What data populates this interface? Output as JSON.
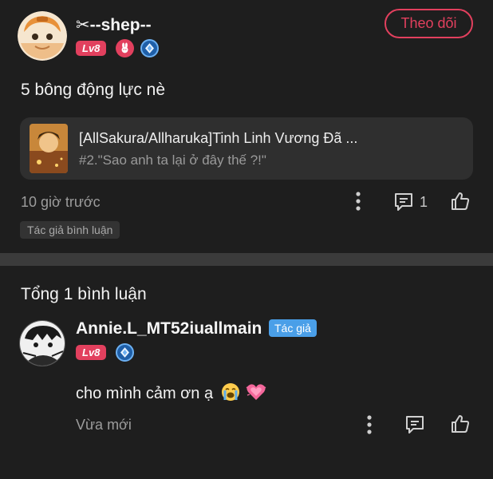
{
  "post": {
    "author": {
      "name": "✂--shep--",
      "level": "Lv8"
    },
    "follow_label": "Theo dõi",
    "title": "5 bông động lực nè",
    "story": {
      "title": "[AllSakura/Allharuka]Tinh Linh Vương Đã ...",
      "chapter": "#2.\"Sao anh ta lại ở đây thế ?!\""
    },
    "time": "10 giờ trước",
    "comment_count": "1",
    "tag": "Tác giả bình luận"
  },
  "comments_section": {
    "heading": "Tổng 1 bình luận",
    "comments": [
      {
        "author": "Annie.L_MT52iuallmain",
        "author_tag": "Tác giả",
        "level": "Lv8",
        "text": "cho mình cảm ơn ạ",
        "emojis": [
          "loudly-crying-face",
          "growing-heart"
        ],
        "time": "Vừa mới"
      }
    ]
  },
  "colors": {
    "background": "#1e1e1e",
    "accent": "#e2405e",
    "card": "#2f2f2f",
    "author_tag": "#4a9fe8"
  }
}
